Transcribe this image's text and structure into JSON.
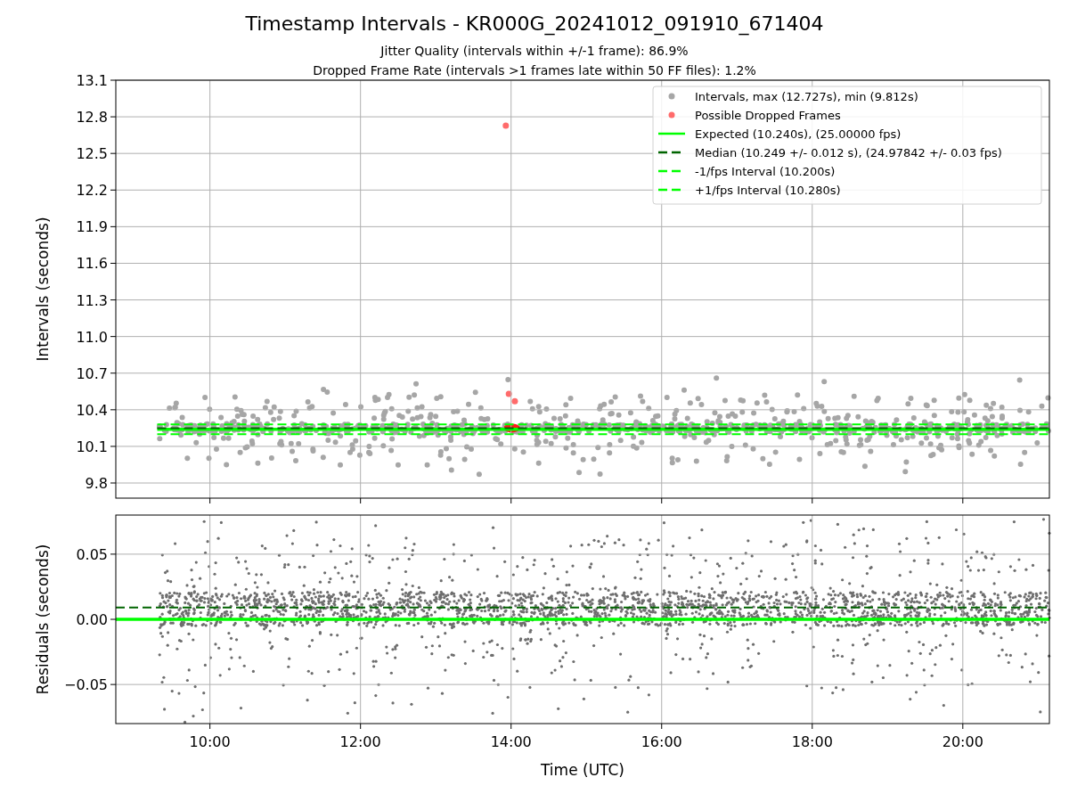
{
  "figure": {
    "title": "Timestamp Intervals - KR000G_20241012_091910_671404",
    "subtitles": [
      "Jitter Quality (intervals within +/-1 frame): 86.9%",
      "Dropped Frame Rate (intervals >1 frames late within 50 FF files): 1.2%"
    ],
    "intervals_plot": {
      "legend": [
        {
          "label": "Intervals, max (12.727s), min (9.812s)",
          "color": "#a6a6a6"
        },
        {
          "label": "Possible Dropped Frames",
          "color": "#ff6b6b"
        }
      ],
      "chart_data": {
        "type": "line",
        "ylabel": "Intervals (seconds)",
        "x": [
          9.3,
          21.15
        ],
        "grid": true,
        "legend": "upper right",
        "series": [
          {
            "name": "Expected (10.240s), (25.00000 fps)",
            "color": "#00ff00",
            "line_style": "solid",
            "values": [
              10.24,
              10.24
            ]
          },
          {
            "name": "Median (10.249 +/- 0.012 s), (24.97842 +/- 0.03 fps)",
            "color": "#006400",
            "line_style": "dashed",
            "values": [
              10.249,
              10.249
            ]
          },
          {
            "name": "-1/fps Interval (10.200s)",
            "color": "#00ff00",
            "line_style": "dashed",
            "values": [
              10.2,
              10.2
            ]
          },
          {
            "name": "+1/fps Interval (10.280s)",
            "color": "#00ff00",
            "line_style": "dashed",
            "values": [
              10.28,
              10.28
            ]
          }
        ],
        "xlim": [
          8.75,
          21.15
        ],
        "ylim": [
          9.676,
          13.1
        ],
        "yticks": [
          {
            "value": 9.8,
            "label": "9.8"
          },
          {
            "value": 10.1,
            "label": "10.1"
          },
          {
            "value": 10.4,
            "label": "10.4"
          },
          {
            "value": 10.7,
            "label": "10.7"
          },
          {
            "value": 11.0,
            "label": "11.0"
          },
          {
            "value": 11.3,
            "label": "11.3"
          },
          {
            "value": 11.6,
            "label": "11.6"
          },
          {
            "value": 11.9,
            "label": "11.9"
          },
          {
            "value": 12.2,
            "label": "12.2"
          },
          {
            "value": 12.5,
            "label": "12.5"
          },
          {
            "value": 12.8,
            "label": "12.8"
          },
          {
            "value": 13.1,
            "label": "13.1"
          }
        ]
      }
    },
    "residuals_plot": {
      "chart_data": {
        "type": "line",
        "xlabel": "Time (UTC)",
        "ylabel": "Residuals (seconds)",
        "x": [
          8.75,
          21.15
        ],
        "grid": true,
        "series": [
          {
            "color": "#00ff00",
            "line_style": "solid",
            "values": [
              0,
              0
            ]
          },
          {
            "color": "#006400",
            "line_style": "dashed",
            "values": [
              0.009,
              0.009
            ]
          }
        ],
        "xlim": [
          8.75,
          21.15
        ],
        "ylim": [
          -0.08,
          0.08
        ],
        "xticks": [
          {
            "value": 10,
            "label": "10:00"
          },
          {
            "value": 12,
            "label": "12:00"
          },
          {
            "value": 14,
            "label": "14:00"
          },
          {
            "value": 16,
            "label": "16:00"
          },
          {
            "value": 18,
            "label": "18:00"
          },
          {
            "value": 20,
            "label": "20:00"
          }
        ],
        "yticks": [
          {
            "value": -0.05,
            "label": "−0.05"
          },
          {
            "value": 0,
            "label": "0.00"
          },
          {
            "value": 0.05,
            "label": "0.05"
          }
        ]
      }
    }
  }
}
